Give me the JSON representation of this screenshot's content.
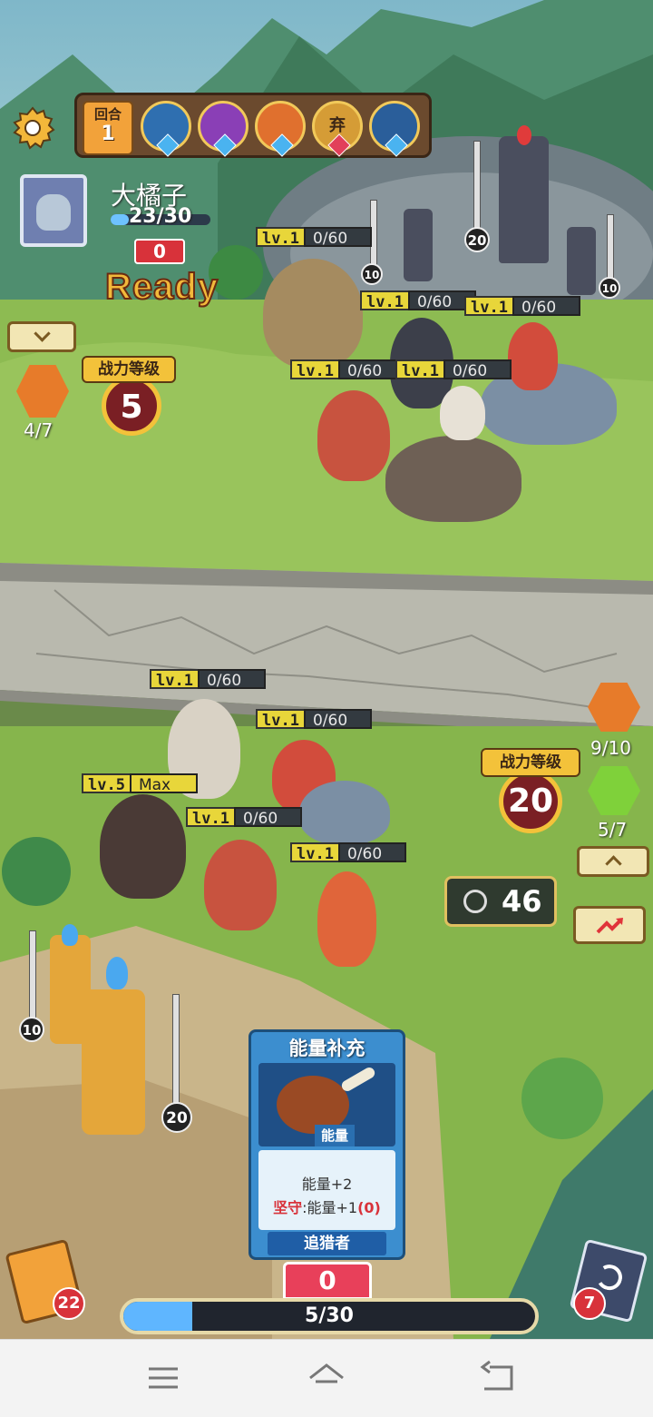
{
  "hud": {
    "round_label": "回合",
    "round_number": "1",
    "player_name": "大橘子",
    "player_hp": "23/30",
    "player_shield": "0",
    "ready_label": "Ready",
    "enemy_power_label": "战力等级",
    "enemy_power_value": "5",
    "enemy_gem_count": "4/7",
    "player_power_label": "战力等级",
    "player_power_value": "20",
    "player_gem_count": "9/10",
    "player_green_count": "5/7",
    "timer_value": "46",
    "energy_value": "0",
    "deck_count": "22",
    "discard_count": "7",
    "energy_bar_text": "5/30",
    "energy_fraction": 0.1667
  },
  "turn_order": [
    {
      "name": "hero-portrait-1",
      "gem": "blue"
    },
    {
      "name": "hero-portrait-2",
      "gem": "blue"
    },
    {
      "name": "hero-portrait-3",
      "gem": "blue"
    },
    {
      "name": "hero-portrait-4",
      "gem": "red",
      "label": "弃"
    },
    {
      "name": "hero-portrait-5",
      "gem": "blue"
    }
  ],
  "enemy_units": [
    {
      "lv": "lv.1",
      "xp": "0/60"
    },
    {
      "lv": "lv.1",
      "xp": "0/60"
    },
    {
      "lv": "lv.1",
      "xp": "0/60"
    },
    {
      "lv": "lv.1",
      "xp": "0/60"
    },
    {
      "lv": "lv.1",
      "xp": "0/60"
    }
  ],
  "player_units": [
    {
      "lv": "lv.1",
      "xp": "0/60"
    },
    {
      "lv": "lv.1",
      "xp": "0/60"
    },
    {
      "lv": "lv.5",
      "xp": "Max"
    },
    {
      "lv": "lv.1",
      "xp": "0/60"
    },
    {
      "lv": "lv.1",
      "xp": "0/60"
    }
  ],
  "towers": {
    "enemy": [
      "10",
      "20",
      "10",
      "10"
    ],
    "player": [
      "10",
      "20"
    ]
  },
  "card": {
    "title": "能量补充",
    "type": "能量",
    "effect_line1": "能量+2",
    "effect_keyword": "坚守",
    "effect_line2": ":能量+1",
    "effect_bonus": "(0)",
    "class": "追猎者"
  },
  "colors": {
    "energy_fill": "#5fb6ff",
    "lv_tag": "#e8d63a",
    "card_frame": "#3c8ecf",
    "ready_text": "#f2b93b",
    "red_badge": "#d8323a"
  }
}
